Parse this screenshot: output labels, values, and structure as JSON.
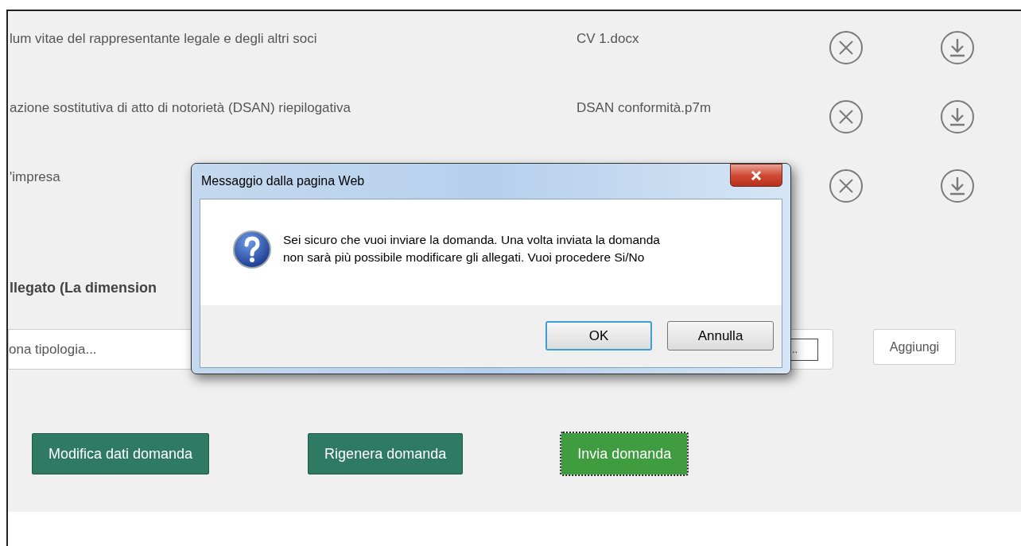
{
  "attachments": [
    {
      "description": "lum vitae del rappresentante legale e degli altri soci",
      "filename": "CV 1.docx"
    },
    {
      "description": "azione sostitutiva di atto di notorietà (DSAN) riepilogativa",
      "filename": "DSAN conformità.p7m"
    },
    {
      "description": "'impresa"
    }
  ],
  "section_title": "llegato (La dimension",
  "type_select": {
    "placeholder": "ona tipologia...",
    "browse_label": ".."
  },
  "add_button": "Aggiungi",
  "actions": [
    {
      "label": "Modifica dati domanda",
      "kind": "secondary",
      "focused": false
    },
    {
      "label": "Rigenera domanda",
      "kind": "secondary",
      "focused": false
    },
    {
      "label": "Invia domanda",
      "kind": "primary",
      "focused": true
    }
  ],
  "dialog": {
    "title": "Messaggio dalla pagina Web",
    "message": "Sei sicuro che vuoi inviare la domanda. Una volta inviata la domanda\nnon sarà più possibile modificare gli allegati. Vuoi procedere Si/No",
    "buttons": [
      {
        "label": "OK",
        "focused": true
      },
      {
        "label": "Annulla",
        "focused": false
      }
    ]
  }
}
